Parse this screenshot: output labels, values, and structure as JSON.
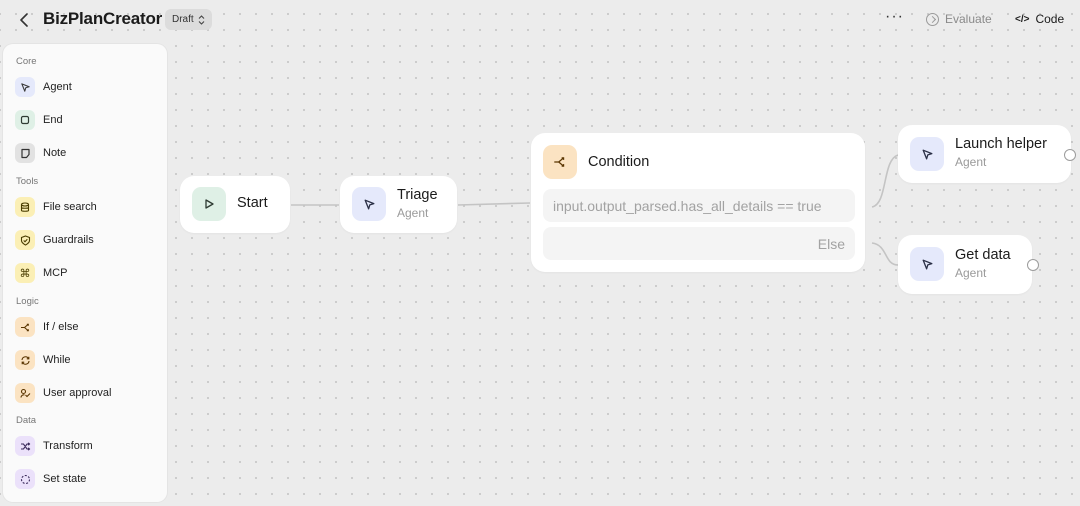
{
  "header": {
    "back_icon": "chevron-left-icon",
    "title": "BizPlanCreator",
    "status": "Draft",
    "more_glyph": "···",
    "evaluate_label": "Evaluate",
    "code_label": "Code",
    "code_glyph": "</>"
  },
  "sidebar": {
    "sections": [
      {
        "label": "Core",
        "items": [
          {
            "label": "Agent",
            "icon": "cursor-arrow-icon",
            "color": "#e5e9fb"
          },
          {
            "label": "End",
            "icon": "square-icon",
            "color": "#dff0e6"
          },
          {
            "label": "Note",
            "icon": "note-icon",
            "color": "#e2e2e2"
          }
        ]
      },
      {
        "label": "Tools",
        "items": [
          {
            "label": "File search",
            "icon": "database-icon",
            "color": "#fbefb5"
          },
          {
            "label": "Guardrails",
            "icon": "shield-icon",
            "color": "#fbefb5"
          },
          {
            "label": "MCP",
            "icon": "command-icon",
            "color": "#fbefb5"
          }
        ]
      },
      {
        "label": "Logic",
        "items": [
          {
            "label": "If / else",
            "icon": "branch-icon",
            "color": "#fbe3c2"
          },
          {
            "label": "While",
            "icon": "loop-icon",
            "color": "#fbe3c2"
          },
          {
            "label": "User approval",
            "icon": "approval-icon",
            "color": "#fbe3c2"
          }
        ]
      },
      {
        "label": "Data",
        "items": [
          {
            "label": "Transform",
            "icon": "shuffle-icon",
            "color": "#ebe1fa"
          },
          {
            "label": "Set state",
            "icon": "dashed-circle-icon",
            "color": "#ebe1fa"
          }
        ]
      }
    ]
  },
  "canvas": {
    "start": {
      "title": "Start",
      "icon": "play-icon"
    },
    "triage": {
      "title": "Triage",
      "subtitle": "Agent",
      "icon": "cursor-arrow-icon"
    },
    "condition": {
      "title": "Condition",
      "icon": "branch-icon",
      "rows": [
        "input.output_parsed.has_all_details == true",
        "Else"
      ]
    },
    "launch_helper": {
      "title": "Launch helper",
      "subtitle": "Agent",
      "icon": "cursor-arrow-icon"
    },
    "get_data": {
      "title": "Get data",
      "subtitle": "Agent",
      "icon": "cursor-arrow-icon"
    }
  },
  "colors": {
    "canvas_bg": "#ececec",
    "agent_accent": "#e5e9fb",
    "start_accent": "#dff0e6",
    "logic_accent": "#fbe3c2"
  }
}
